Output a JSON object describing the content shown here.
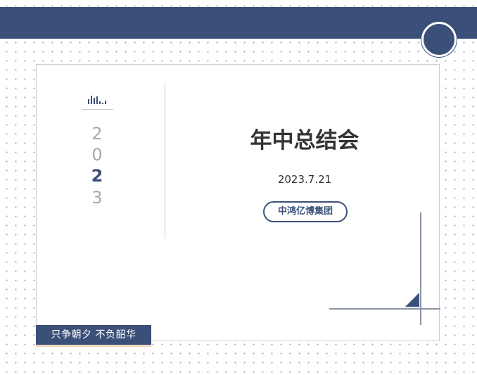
{
  "slide": {
    "year_digits": [
      "2",
      "0",
      "2",
      "3"
    ],
    "active_digit_index": 2,
    "title": "年中总结会",
    "date": "2023.7.21",
    "company": "中鸿亿博集团",
    "slogan": "只争朝夕 不负韶华"
  },
  "icons": {
    "bars": "bar-chart-icon",
    "corner": "corner-triangle-icon"
  },
  "colors": {
    "accent": "#3b5079",
    "text": "#333333",
    "muted": "#a5a8ae",
    "slogan_underline": "#f2d7bc"
  }
}
